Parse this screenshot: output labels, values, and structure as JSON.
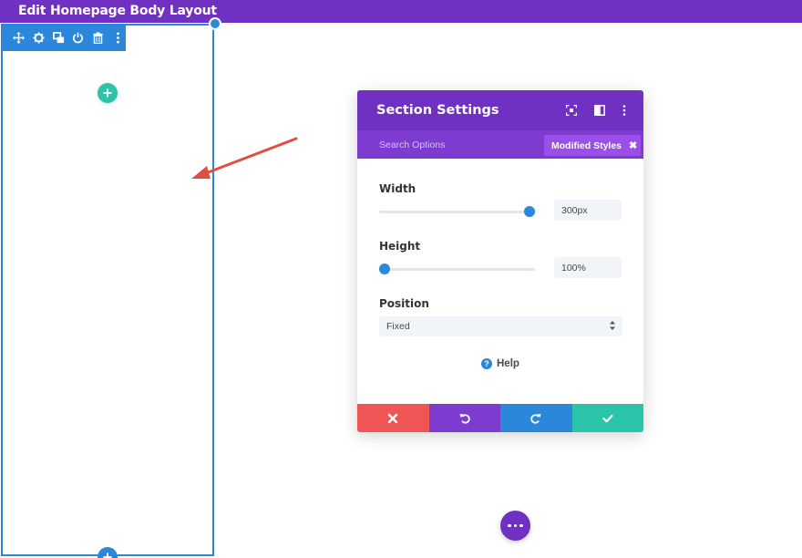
{
  "topbar": {
    "title": "Edit Homepage Body Layout"
  },
  "canvas": {
    "section_toolbar": {
      "icons": [
        "move-icon",
        "gear-icon",
        "duplicate-icon",
        "power-icon",
        "trash-icon",
        "more-vertical-icon"
      ]
    },
    "add_row_icon": "plus-icon",
    "add_section_icon": "plus-icon"
  },
  "modal": {
    "title": "Section Settings",
    "header_icons": [
      "expand-icon",
      "split-view-icon",
      "more-vertical-icon"
    ],
    "search_placeholder": "Search Options",
    "filter_chip": {
      "label": "Modified Styles",
      "close": "✖"
    },
    "fields": {
      "width": {
        "label": "Width",
        "value": "300px",
        "slider_level": 1.0
      },
      "height": {
        "label": "Height",
        "value": "100%",
        "slider_level": 0.0
      },
      "position": {
        "label": "Position",
        "selected": "Fixed"
      }
    },
    "help": {
      "icon": "?",
      "label": "Help"
    },
    "footer_buttons": [
      {
        "name": "discard",
        "icon": "close-icon",
        "color": "#ef5555"
      },
      {
        "name": "undo",
        "icon": "undo-icon",
        "color": "#7d3bcf"
      },
      {
        "name": "redo",
        "icon": "redo-icon",
        "color": "#2b87da"
      },
      {
        "name": "save",
        "icon": "check-icon",
        "color": "#29c4a9"
      }
    ]
  },
  "colors": {
    "purple": "#7030c2",
    "purple_light": "#7e3bd0",
    "blue": "#2b87da",
    "teal": "#29c4a9",
    "red_arrow": "#e14d43"
  },
  "fab": {
    "icon": "more-horizontal-icon"
  }
}
